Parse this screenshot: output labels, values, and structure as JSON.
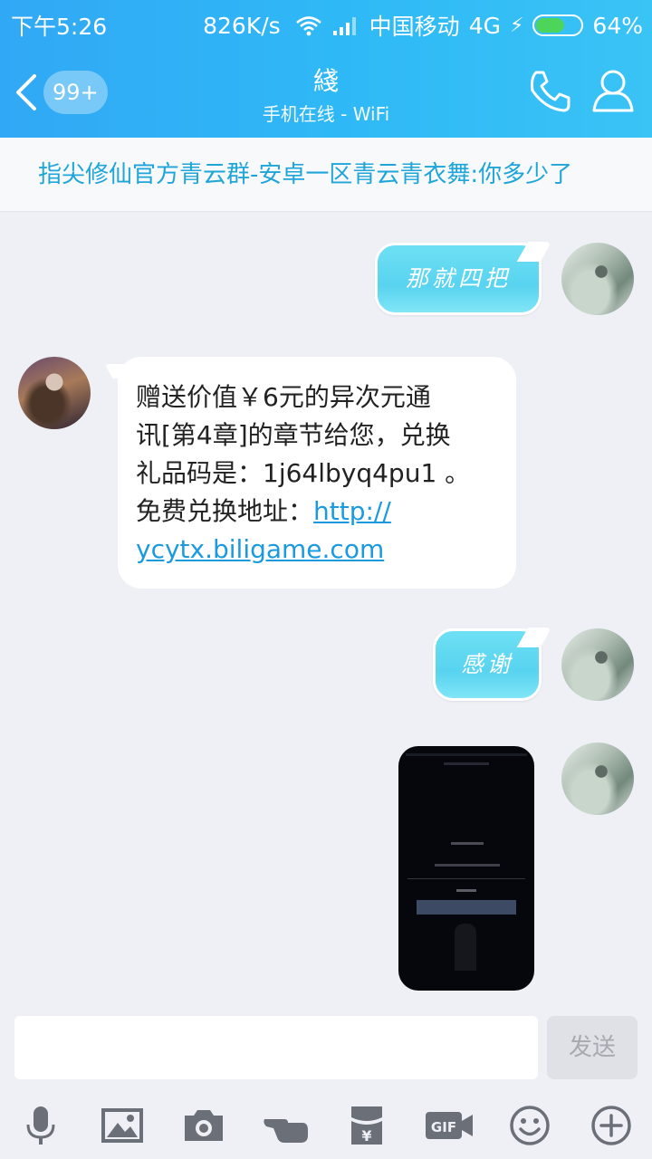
{
  "status_bar": {
    "time": "下午5:26",
    "speed": "826K/s",
    "carrier": "中国移动",
    "network": "4G",
    "battery": "64%",
    "battery_level": 0.64
  },
  "header": {
    "unread_badge": "99+",
    "title": "綫",
    "subtitle": "手机在线 - WiFi"
  },
  "notice": "指尖修仙官方青云群-安卓一区青云青衣舞:你多少了",
  "messages": {
    "m1": "那就四把",
    "m2": {
      "line1": "赠送价值￥6元的异次元通",
      "line2": "讯[第4章]的章节给您，兑换",
      "line3": "礼品码是：1j64lbyq4pu1 。",
      "line4_prefix": "免费兑换地址：",
      "link_part1": "http://",
      "link_part2": "ycytx.biligame.com"
    },
    "m3": "感谢"
  },
  "input": {
    "send_label": "发送"
  },
  "toolbar": {
    "icons": [
      "microphone-icon",
      "image-icon",
      "camera-icon",
      "poke-hand-icon",
      "red-packet-icon",
      "gif-icon",
      "emoji-icon",
      "plus-icon"
    ]
  }
}
